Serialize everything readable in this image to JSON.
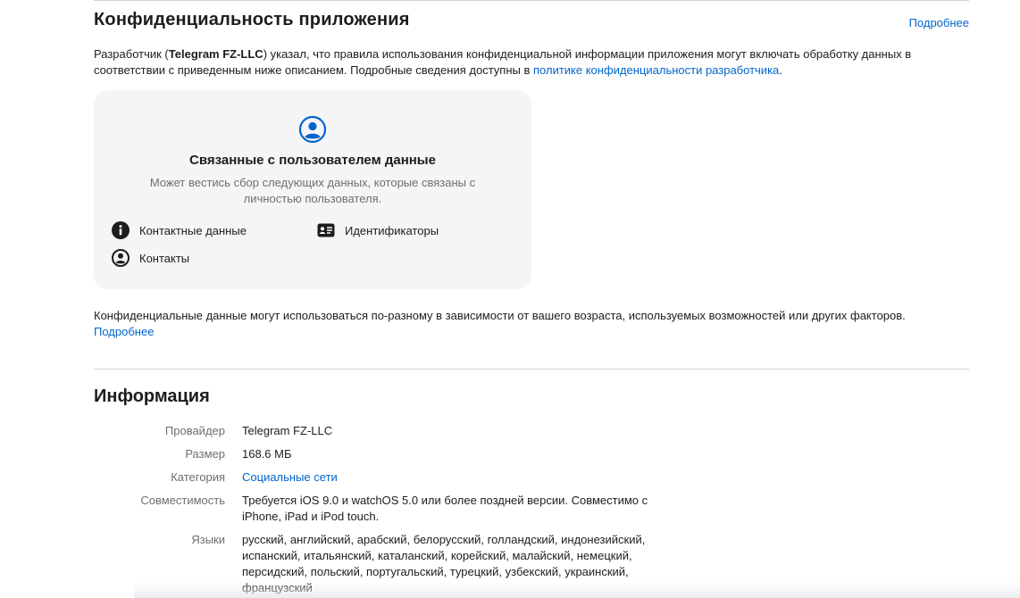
{
  "privacy": {
    "title": "Конфиденциальность приложения",
    "more_link": "Подробнее",
    "intro_prefix": "Разработчик (",
    "developer": "Telegram FZ-LLC",
    "intro_middle": ") указал, что правила использования конфиденциальной информации приложения могут включать обработку данных в соответствии с приведенным ниже описанием. Подробные сведения доступны в ",
    "policy_link": "политике конфиденциальности разработчика",
    "intro_suffix": ".",
    "card": {
      "icon": "person-circle-icon",
      "title": "Связанные с пользователем данные",
      "description": "Может вестись сбор следующих данных, которые связаны с личностью пользователя.",
      "items": [
        {
          "icon": "info-circle-icon",
          "label": "Контактные данные"
        },
        {
          "icon": "id-card-icon",
          "label": "Идентификаторы"
        },
        {
          "icon": "person-circle-icon",
          "label": "Контакты"
        }
      ]
    },
    "note": "Конфиденциальные данные могут использоваться по-разному в зависимости от вашего возраста, используемых возможностей или других факторов.",
    "note_link": "Подробнее"
  },
  "information": {
    "title": "Информация",
    "rows": [
      {
        "label": "Провайдер",
        "value": "Telegram FZ-LLC"
      },
      {
        "label": "Размер",
        "value": "168.6 МБ"
      },
      {
        "label": "Категория",
        "value": "Социальные сети"
      },
      {
        "label": "Совместимость",
        "value": "Требуется iOS 9.0 и watchOS 5.0 или более поздней версии. Совместимо с iPhone, iPad и iPod touch."
      },
      {
        "label": "Языки",
        "value": "русский, английский, арабский, белорусский, голландский, индонезийский, испанский, итальянский, каталанский, корейский, малайский, немецкий, персидский, польский, португальский, турецкий, узбекский, украинский, французский"
      }
    ]
  },
  "colors": {
    "link": "#0066cc",
    "text": "#1d1d1f",
    "secondary": "#6e6e73",
    "card_bg": "#f5f5f7"
  }
}
